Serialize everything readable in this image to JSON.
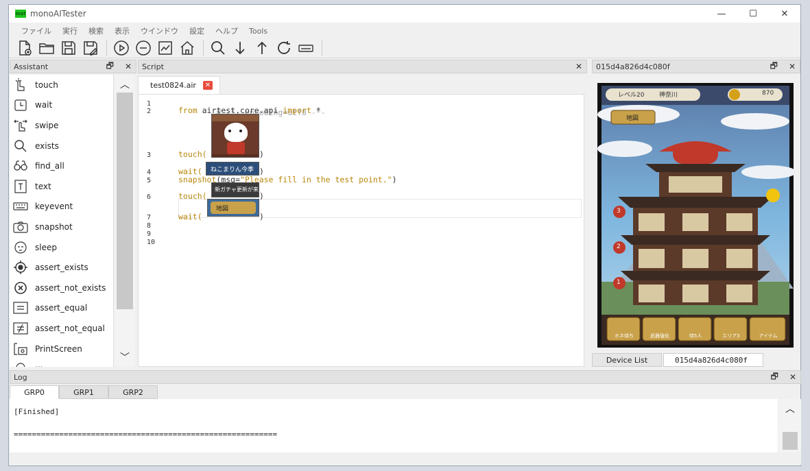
{
  "window": {
    "title": "monoAITester",
    "logo": "mat",
    "minimize": "—",
    "maximize": "☐",
    "close": "✕"
  },
  "menu": [
    "ファイル",
    "実行",
    "検索",
    "表示",
    "ウインドウ",
    "設定",
    "ヘルプ",
    "Tools"
  ],
  "toolbar": {
    "icons": [
      "new-file-icon",
      "open-folder-icon",
      "save-icon",
      "save-as-icon",
      "play-icon",
      "stop-icon",
      "report-icon",
      "home-icon",
      "search-icon",
      "arrow-down-icon",
      "arrow-up-icon",
      "refresh-icon",
      "keyboard-icon"
    ]
  },
  "assistant": {
    "title": "Assistant",
    "restore": "🗗",
    "close": "✕",
    "items": [
      {
        "label": "touch",
        "icon": "hand-pointer-icon"
      },
      {
        "label": "wait",
        "icon": "alarm-clock-icon"
      },
      {
        "label": "swipe",
        "icon": "swipe-hand-icon"
      },
      {
        "label": "exists",
        "icon": "magnifier-icon"
      },
      {
        "label": "find_all",
        "icon": "binoculars-icon"
      },
      {
        "label": "text",
        "icon": "text-box-icon"
      },
      {
        "label": "keyevent",
        "icon": "keyboard-icon"
      },
      {
        "label": "snapshot",
        "icon": "camera-icon"
      },
      {
        "label": "sleep",
        "icon": "sleep-face-icon"
      },
      {
        "label": "assert_exists",
        "icon": "target-icon"
      },
      {
        "label": "assert_not_exists",
        "icon": "x-circle-icon"
      },
      {
        "label": "assert_equal",
        "icon": "equal-box-icon"
      },
      {
        "label": "assert_not_equal",
        "icon": "not-equal-box-icon"
      },
      {
        "label": "PrintScreen",
        "icon": "print-screen-icon"
      },
      {
        "label": "...",
        "icon": "cut-off-icon"
      }
    ]
  },
  "script": {
    "title": "Script",
    "close": "✕",
    "tab": {
      "label": "test0824.air",
      "close": "✕"
    },
    "line_numbers": [
      "1",
      "2",
      "3",
      "4",
      "5",
      "6",
      "7",
      "8",
      "9",
      "10"
    ],
    "lines": {
      "l1": "# -*- encoding=utf8 -*-",
      "l2_kw": "from",
      "l2_mod": " airtest.core.api ",
      "l2_imp": "import",
      "l2_star": " *",
      "touch": "touch(",
      "wait": "wait(",
      "close_paren": ")",
      "snapshot_fn": "snapshot",
      "snapshot_open": "(msg=",
      "snapshot_str": "\"Please fill in the test point.\"",
      "snapshot_close": ")"
    },
    "thumb_labels": {
      "t4": "ねこまりん今季",
      "t6": "新ガチャ更新が来たよ",
      "t7": "地図"
    }
  },
  "device": {
    "title": "015d4a826d4c080f",
    "restore": "🗗",
    "close": "✕",
    "list_tab": "Device List",
    "list_value": "015d4a826d4c080f",
    "game": {
      "level": "レベル20",
      "location": "神奈川",
      "coins": "870",
      "map_button": "地図",
      "floors": [
        "3",
        "2",
        "1"
      ],
      "bottom_menu": [
        "ホネ待ち",
        "武器強化",
        "侍5人",
        "エリア3",
        "アイテム"
      ]
    }
  },
  "log": {
    "title": "Log",
    "restore": "🗗",
    "close": "✕",
    "tabs": [
      "GRP0",
      "GRP1",
      "GRP2"
    ],
    "line1": "[Finished]",
    "line2": "=========================================================="
  }
}
